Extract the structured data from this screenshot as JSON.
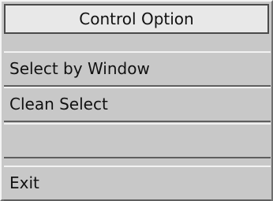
{
  "menu": {
    "title": "Control Option",
    "items": [
      {
        "label": "Select by Window"
      },
      {
        "label": "Clean Select"
      },
      {
        "label": ""
      },
      {
        "label": "Exit"
      }
    ]
  },
  "colors": {
    "panel_background": "#c8c8c8",
    "title_background": "#e8e8e8",
    "text": "#111111",
    "highlight": "#f4f4f4",
    "shadow": "#6e6e6e"
  }
}
